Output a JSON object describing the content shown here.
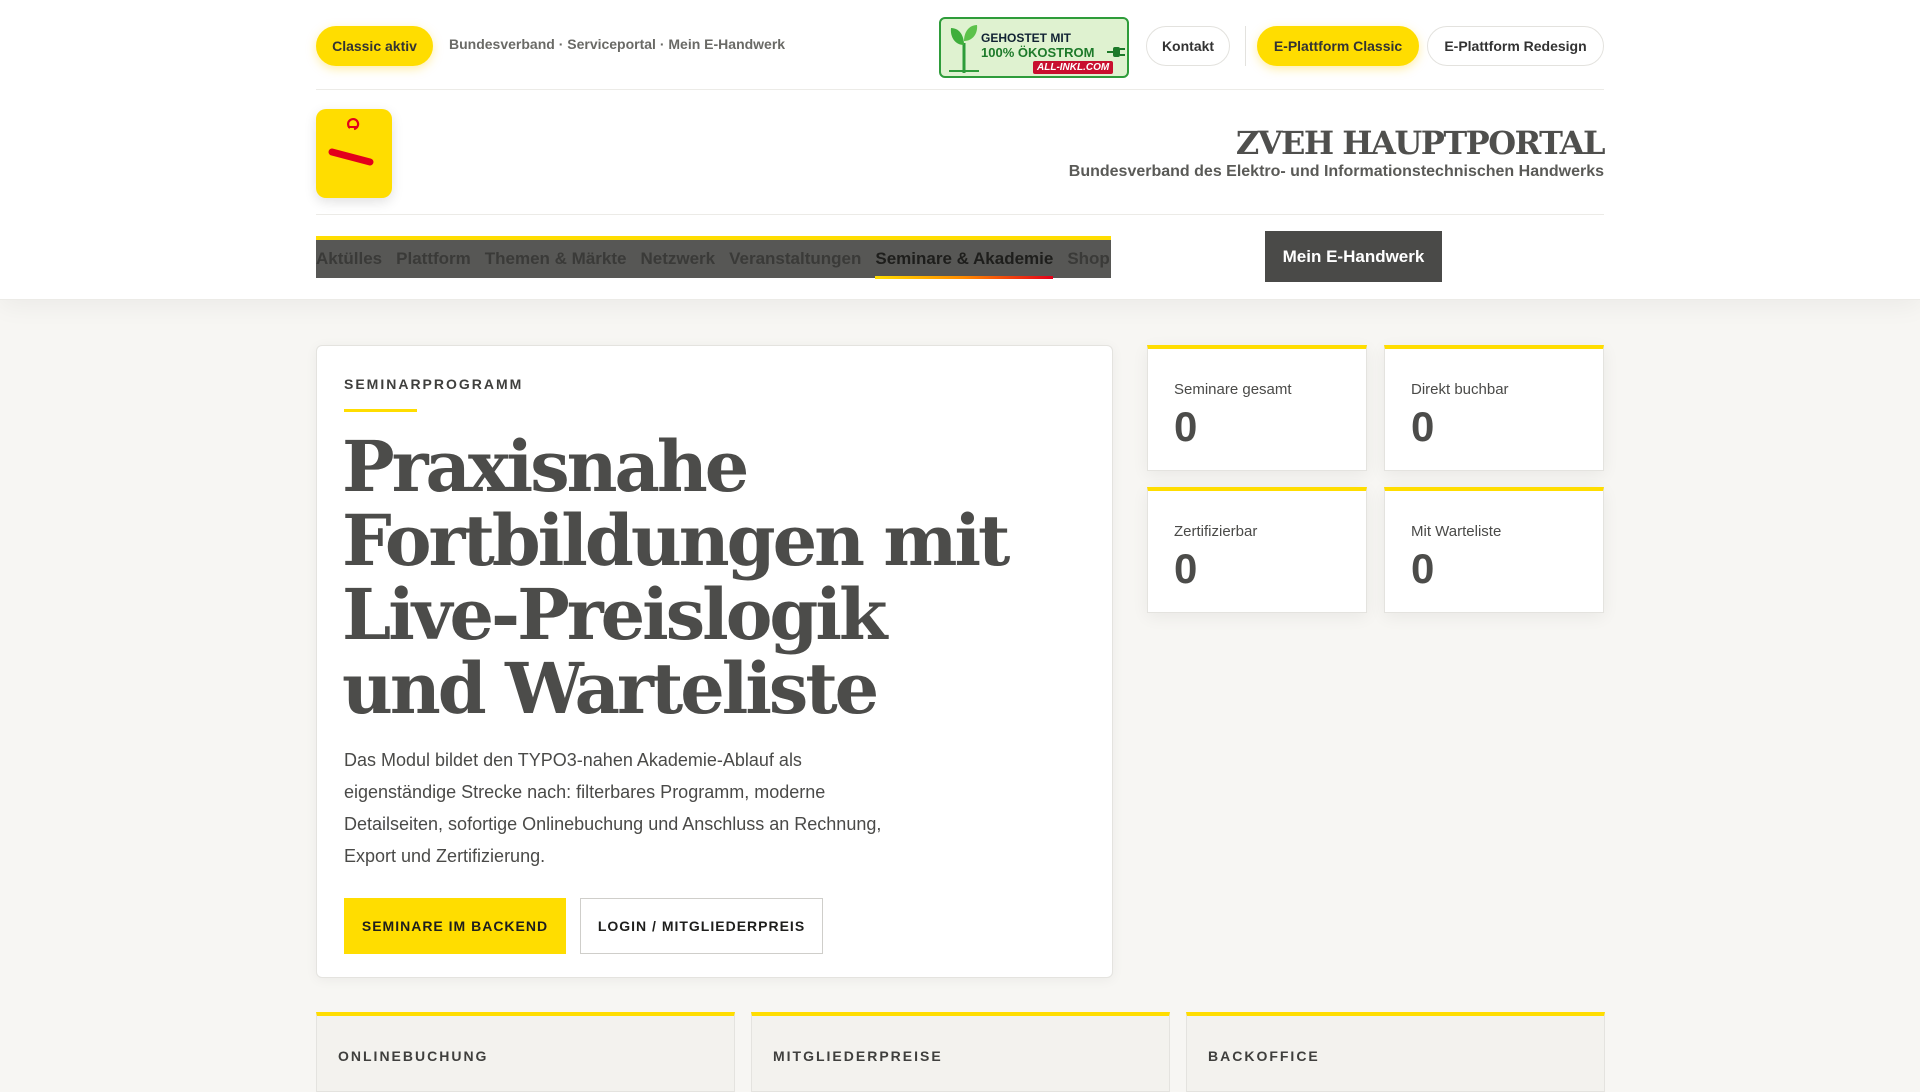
{
  "topbar": {
    "classic_badge": "Classic aktiv",
    "breadcrumb": "Bundesverband · Serviceportal · Mein E-Handwerk",
    "eco_badge": {
      "line1": "GEHOSTET MIT",
      "line2": "100% ÖKOSTROM",
      "line3": "ALL-INKL.COM",
      "icons": [
        "plant-icon",
        "plug-icon"
      ]
    },
    "kontakt": "Kontakt",
    "eplattform_classic": "E-Plattform Classic",
    "eplattform_redesign": "E-Plattform Redesign"
  },
  "brand": {
    "title": "ZVEH HAUPTPORTAL",
    "subtitle": "Bundesverband des Elektro- und Informationstechnischen Handwerks"
  },
  "nav": {
    "items": [
      {
        "label": "Aktülles",
        "active": false
      },
      {
        "label": "Plattform",
        "active": false
      },
      {
        "label": "Themen & Märkte",
        "active": false
      },
      {
        "label": "Netzwerk",
        "active": false
      },
      {
        "label": "Veranstaltungen",
        "active": false
      },
      {
        "label": "Seminare & Akademie",
        "active": true
      },
      {
        "label": "Shop",
        "active": false
      }
    ],
    "mein_ehandwerk": "Mein E-Handwerk"
  },
  "hero": {
    "eyebrow": "SEMINARPROGRAMM",
    "headline_lines": [
      "Praxisnahe",
      "Fortbildungen mit",
      "Live-Preislogik",
      "und Warteliste"
    ],
    "lead_lines": [
      "Das Modul bildet den TYPO3-nahen Akademie-Ablauf als",
      "eigenständige Strecke nach: filterbares Programm, moderne",
      "Detailseiten, sofortige Onlinebuchung und Anschluss an Rechnung,",
      "Export und Zertifizierung."
    ],
    "primary_button": "SEMINARE IM BACKEND",
    "secondary_button": "LOGIN / MITGLIEDERPREIS"
  },
  "stats": [
    {
      "label": "Seminare gesamt",
      "value": "0"
    },
    {
      "label": "Direkt buchbar",
      "value": "0"
    },
    {
      "label": "Zertifizierbar",
      "value": "0"
    },
    {
      "label": "Mit Warteliste",
      "value": "0"
    }
  ],
  "features": [
    {
      "title": "ONLINEBUCHUNG"
    },
    {
      "title": "MITGLIEDERPREISE"
    },
    {
      "title": "BACKOFFICE"
    }
  ],
  "colors": {
    "accent": "#ffdd00",
    "text": "#4a4a48",
    "nav_bg": "#575755",
    "button_dark": "#4a4a48",
    "eco_green": "#2e9c3a",
    "logo_red": "#e3001b"
  }
}
